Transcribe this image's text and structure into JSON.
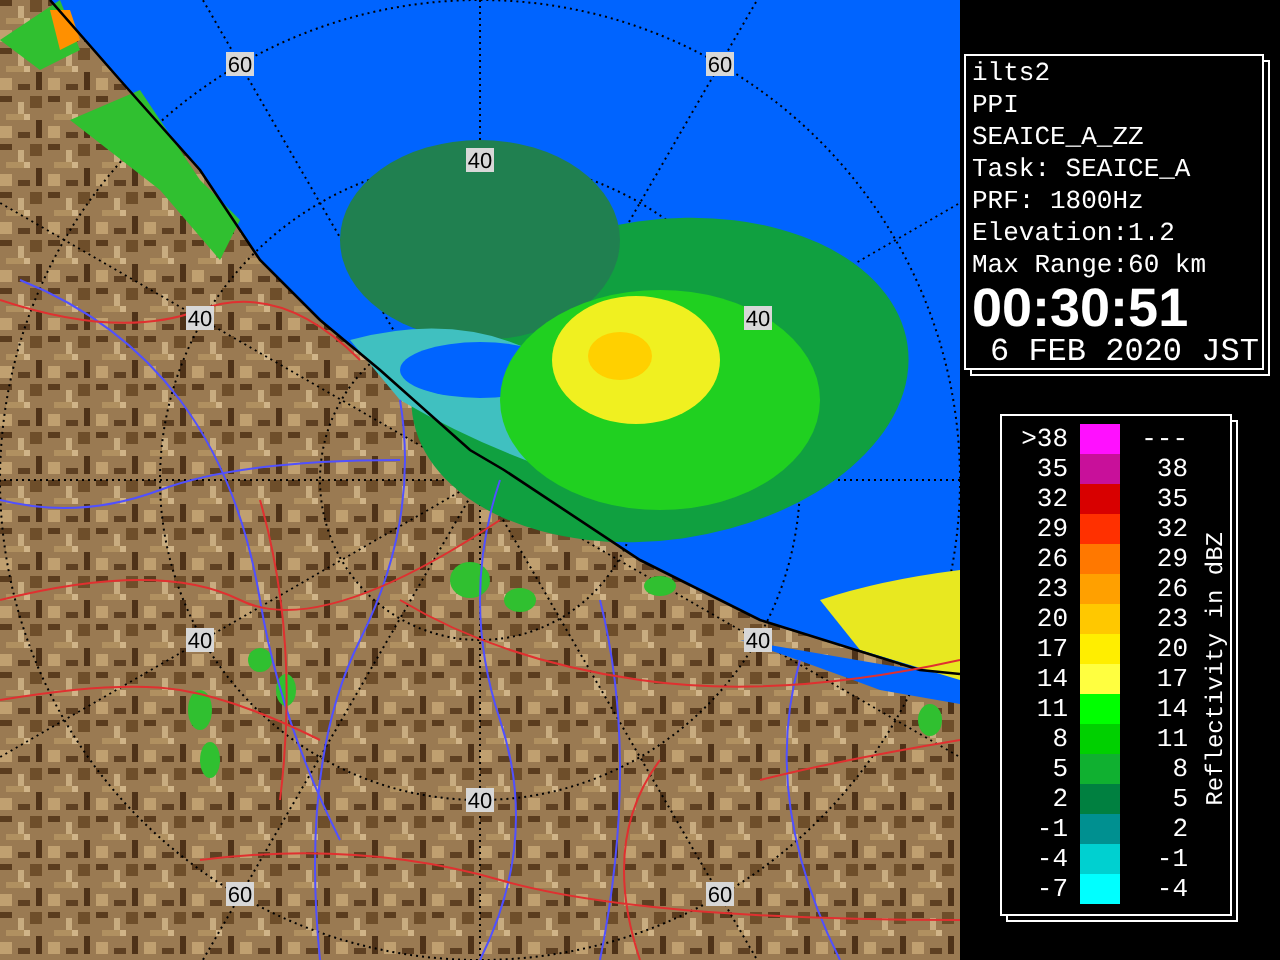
{
  "radar_map": {
    "range_labels": [
      {
        "text": "60"
      },
      {
        "text": "60"
      },
      {
        "text": "40"
      },
      {
        "text": "40"
      },
      {
        "text": "40"
      },
      {
        "text": "40"
      },
      {
        "text": "40"
      },
      {
        "text": "40"
      },
      {
        "text": "60"
      },
      {
        "text": "60"
      }
    ]
  },
  "info_panel": {
    "lines": [
      "ilts2",
      "PPI",
      "SEAICE_A_ZZ",
      "Task: SEAICE_A",
      "PRF: 1800Hz",
      "Elevation:1.2",
      "Max Range:60 km"
    ],
    "time": "00:30:51",
    "date": "6 FEB 2020 JST"
  },
  "legend": {
    "title": "Reflectivity in dBZ",
    "rows": [
      {
        "low": ">38",
        "high": "---",
        "color": "#ff10ff"
      },
      {
        "low": "35",
        "high": "38",
        "color": "#c8109a"
      },
      {
        "low": "32",
        "high": "35",
        "color": "#d80000"
      },
      {
        "low": "29",
        "high": "32",
        "color": "#ff3000"
      },
      {
        "low": "26",
        "high": "29",
        "color": "#ff7800"
      },
      {
        "low": "23",
        "high": "26",
        "color": "#ffa000"
      },
      {
        "low": "20",
        "high": "23",
        "color": "#ffc800"
      },
      {
        "low": "17",
        "high": "20",
        "color": "#ffee00"
      },
      {
        "low": "14",
        "high": "17",
        "color": "#ffff40"
      },
      {
        "low": "11",
        "high": "14",
        "color": "#00ff00"
      },
      {
        "low": "8",
        "high": "11",
        "color": "#00d000"
      },
      {
        "low": "5",
        "high": "8",
        "color": "#10b030"
      },
      {
        "low": "2",
        "high": "5",
        "color": "#008040"
      },
      {
        "low": "-1",
        "high": "2",
        "color": "#009090"
      },
      {
        "low": "-4",
        "high": "-1",
        "color": "#00d0d0"
      },
      {
        "low": "-7",
        "high": "-4",
        "color": "#00ffff"
      }
    ]
  }
}
